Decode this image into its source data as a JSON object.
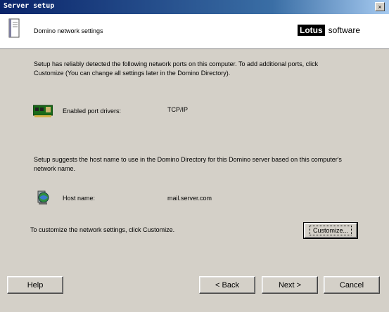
{
  "window": {
    "title": "Server setup",
    "close_glyph": "×"
  },
  "header": {
    "title": "Domino network settings",
    "logo_bold": "Lotus",
    "logo_text": "software"
  },
  "intro": "Setup has reliably detected the following network ports on this computer. To add additional ports, click Customize (You can change all settings later in the Domino Directory).",
  "ports": {
    "label": "Enabled port drivers:",
    "value": "TCP/IP",
    "icon": "network-card-icon"
  },
  "hostname_note": "Setup suggests the host name to use in the Domino Directory for this Domino server based on this computer's network name.",
  "host": {
    "label": "Host name:",
    "value": "mail.server.com",
    "icon": "globe-computer-icon"
  },
  "customize_note": "To customize the network settings, click Customize.",
  "buttons": {
    "customize": "Customize...",
    "help": "Help",
    "back": "< Back",
    "next": "Next >",
    "cancel": "Cancel"
  },
  "colors": {
    "titlebar": "#0a246a",
    "dialog": "#d4d0c8"
  }
}
